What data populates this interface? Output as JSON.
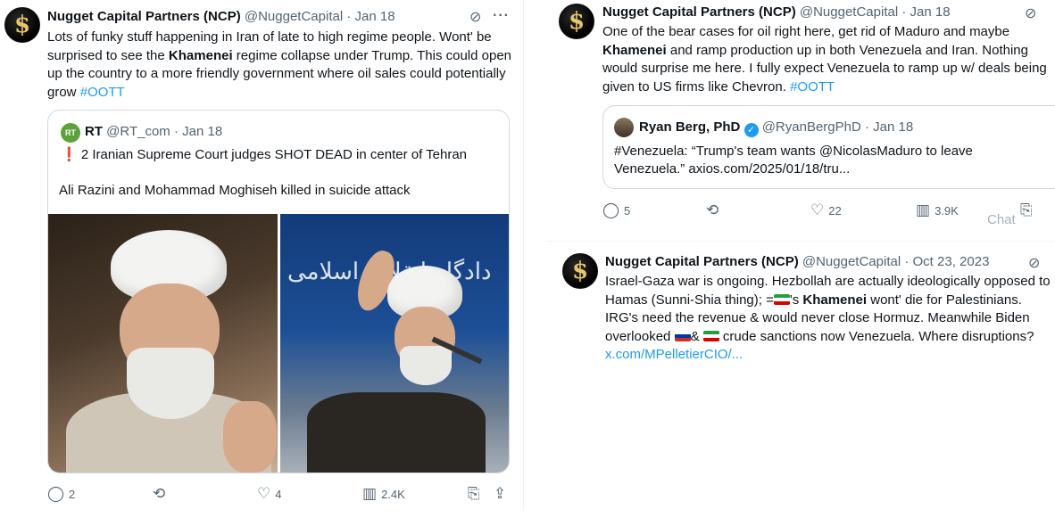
{
  "tweet1": {
    "avatar_glyph": "$",
    "name": "Nugget Capital Partners (NCP)",
    "handle": "@NuggetCapital",
    "separator": "·",
    "date": "Jan 18",
    "text_a": "Lots of funky stuff happening in Iran of late to high regime people. Wont' be surprised to see the ",
    "text_bold": "Khamenei",
    "text_b": " regime collapse under Trump.  This could open up the country to a more friendly government where oil sales could potentially grow ",
    "hashtag": "#OOTT",
    "quote": {
      "logo_text": "RT",
      "name": "RT",
      "handle": "@RT_com",
      "separator": "·",
      "date": "Jan 18",
      "alert_mark": "❗",
      "line1": "2 Iranian Supreme Court judges SHOT DEAD in center of Tehran",
      "line2": "Ali Razini and Mohammad Moghiseh killed in suicide attack",
      "photo_right_script": "دادگاه انقلاب اسلامی"
    },
    "replies": "2",
    "reposts": "",
    "likes": "4",
    "views": "2.4K"
  },
  "tweet2": {
    "avatar_glyph": "$",
    "name": "Nugget Capital Partners (NCP)",
    "handle": "@NuggetCapital",
    "separator": "·",
    "date": "Jan 18",
    "text_a": "One of the bear cases for oil right here, get rid of Maduro and maybe ",
    "text_bold": "Khamenei",
    "text_b": " and ramp production up in both Venezuela and Iran. Nothing would surprise me here. I fully expect Venezuela to ramp up w/ deals being given to US firms like Chevron. ",
    "hashtag": "#OOTT",
    "quote": {
      "name": "Ryan Berg, PhD",
      "handle": "@RyanBergPhD",
      "separator": "·",
      "date": "Jan 18",
      "line1": "#Venezuela: “Trump's team wants @NicolasMaduro to leave",
      "line2": "Venezuela.”  axios.com/2025/01/18/tru..."
    },
    "replies": "5",
    "reposts": "",
    "likes": "22",
    "views": "3.9K",
    "ghost_text": "Chat"
  },
  "tweet3": {
    "avatar_glyph": "$",
    "name": "Nugget Capital Partners (NCP)",
    "handle": "@NuggetCapital",
    "separator": "·",
    "date": "Oct 23, 2023",
    "line1": "Israel-Gaza war is ongoing. Hezbollah are actually ideologically opposed to",
    "line2": "Hamas (Sunni-Shia thing); =",
    "line2_b": "'s ",
    "line2_bold": "Khamenei",
    "line2_c": " wont' die for Palestinians.",
    "line3": "IRG's need the revenue & would never close Hormuz. Meanwhile Biden",
    "line4_a": "overlooked ",
    "line4_b": "& ",
    "line4_c": " crude sanctions now Venezuela. Where disruptions?",
    "link": "x.com/MPelletierCIO/..."
  },
  "icons": {
    "grok": "⊘",
    "more": "···",
    "reply": "💬",
    "repost": "⟲",
    "like": "♡",
    "views": "📊",
    "bookmark": "🔖",
    "share": "⇪"
  }
}
